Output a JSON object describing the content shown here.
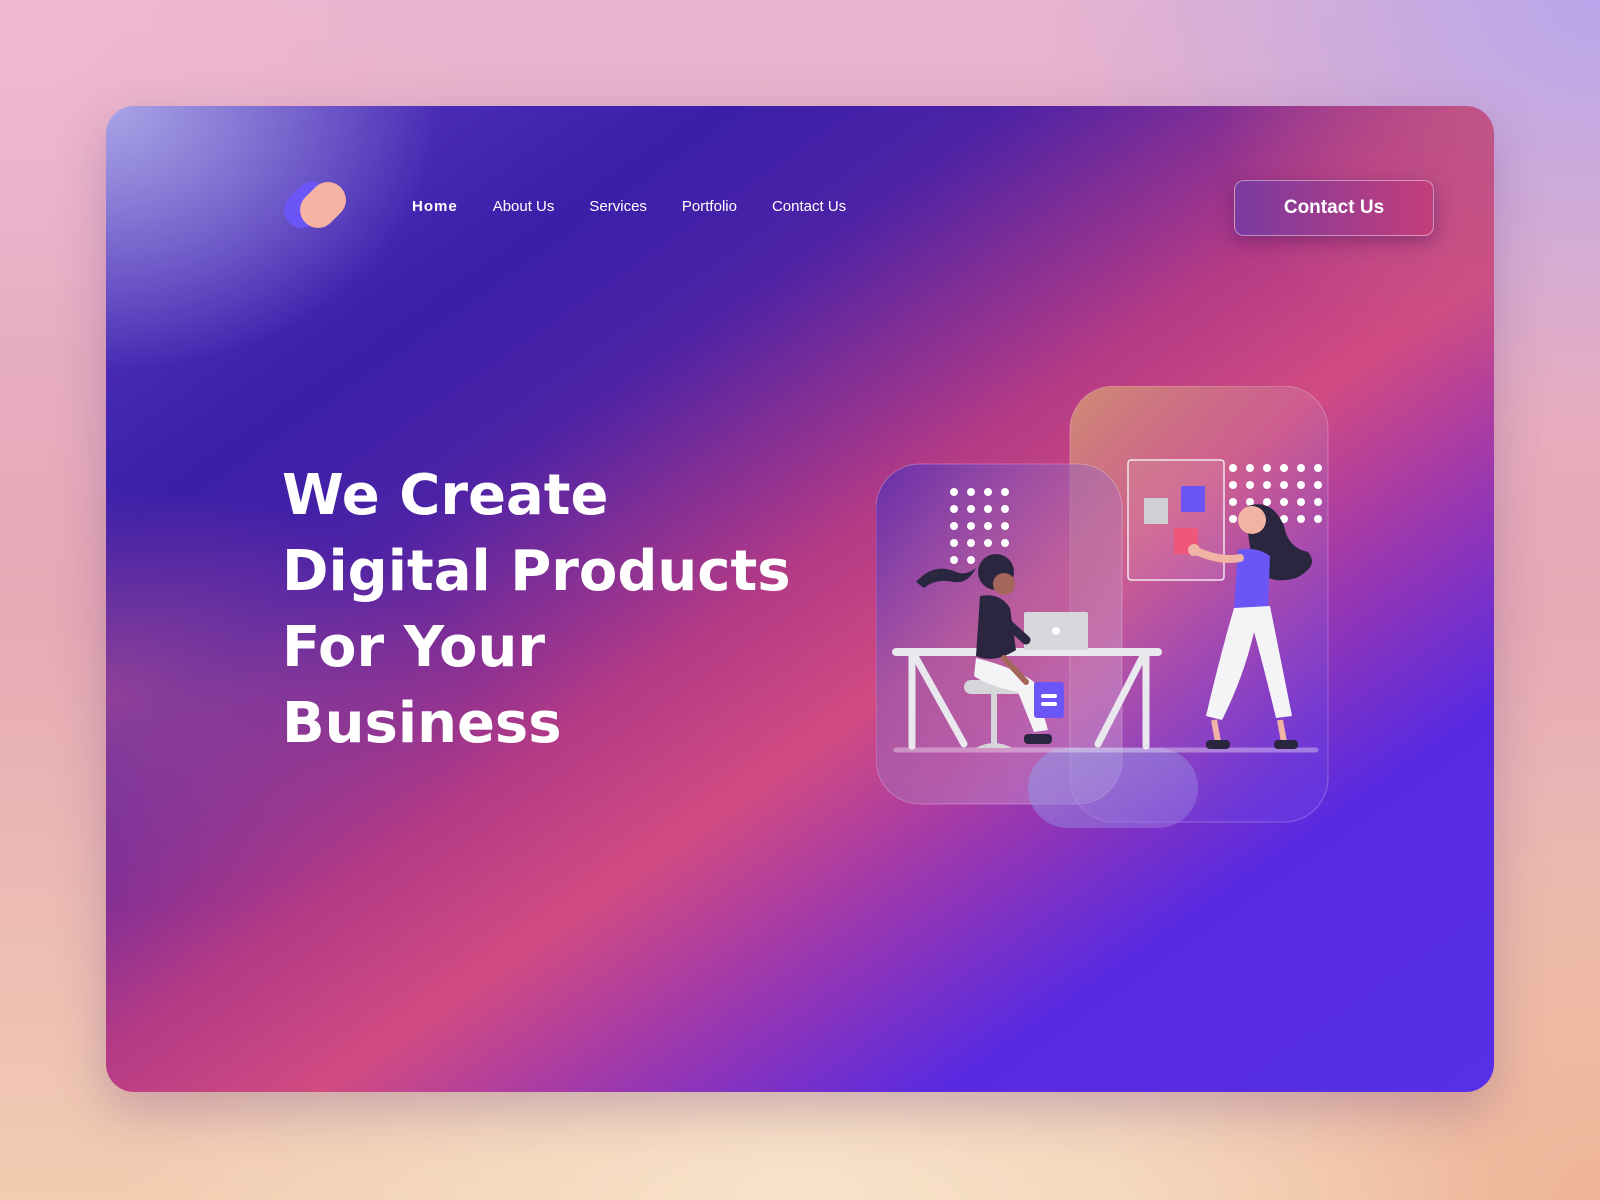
{
  "nav": {
    "links": [
      {
        "label": "Home",
        "active": true
      },
      {
        "label": "About Us",
        "active": false
      },
      {
        "label": "Services",
        "active": false
      },
      {
        "label": "Portfolio",
        "active": false
      },
      {
        "label": "Contact Us",
        "active": false
      }
    ],
    "cta_label": "Contact Us"
  },
  "hero": {
    "lines": [
      "We Create",
      "Digital Products",
      "For Your",
      "Business"
    ]
  },
  "colors": {
    "brand_purple": "#6b55f6",
    "brand_peach": "#f6b2a2",
    "accent_pink": "#d24b82",
    "deep_indigo": "#3b1fa9"
  },
  "illustration": {
    "icon": "people-working-illustration"
  }
}
